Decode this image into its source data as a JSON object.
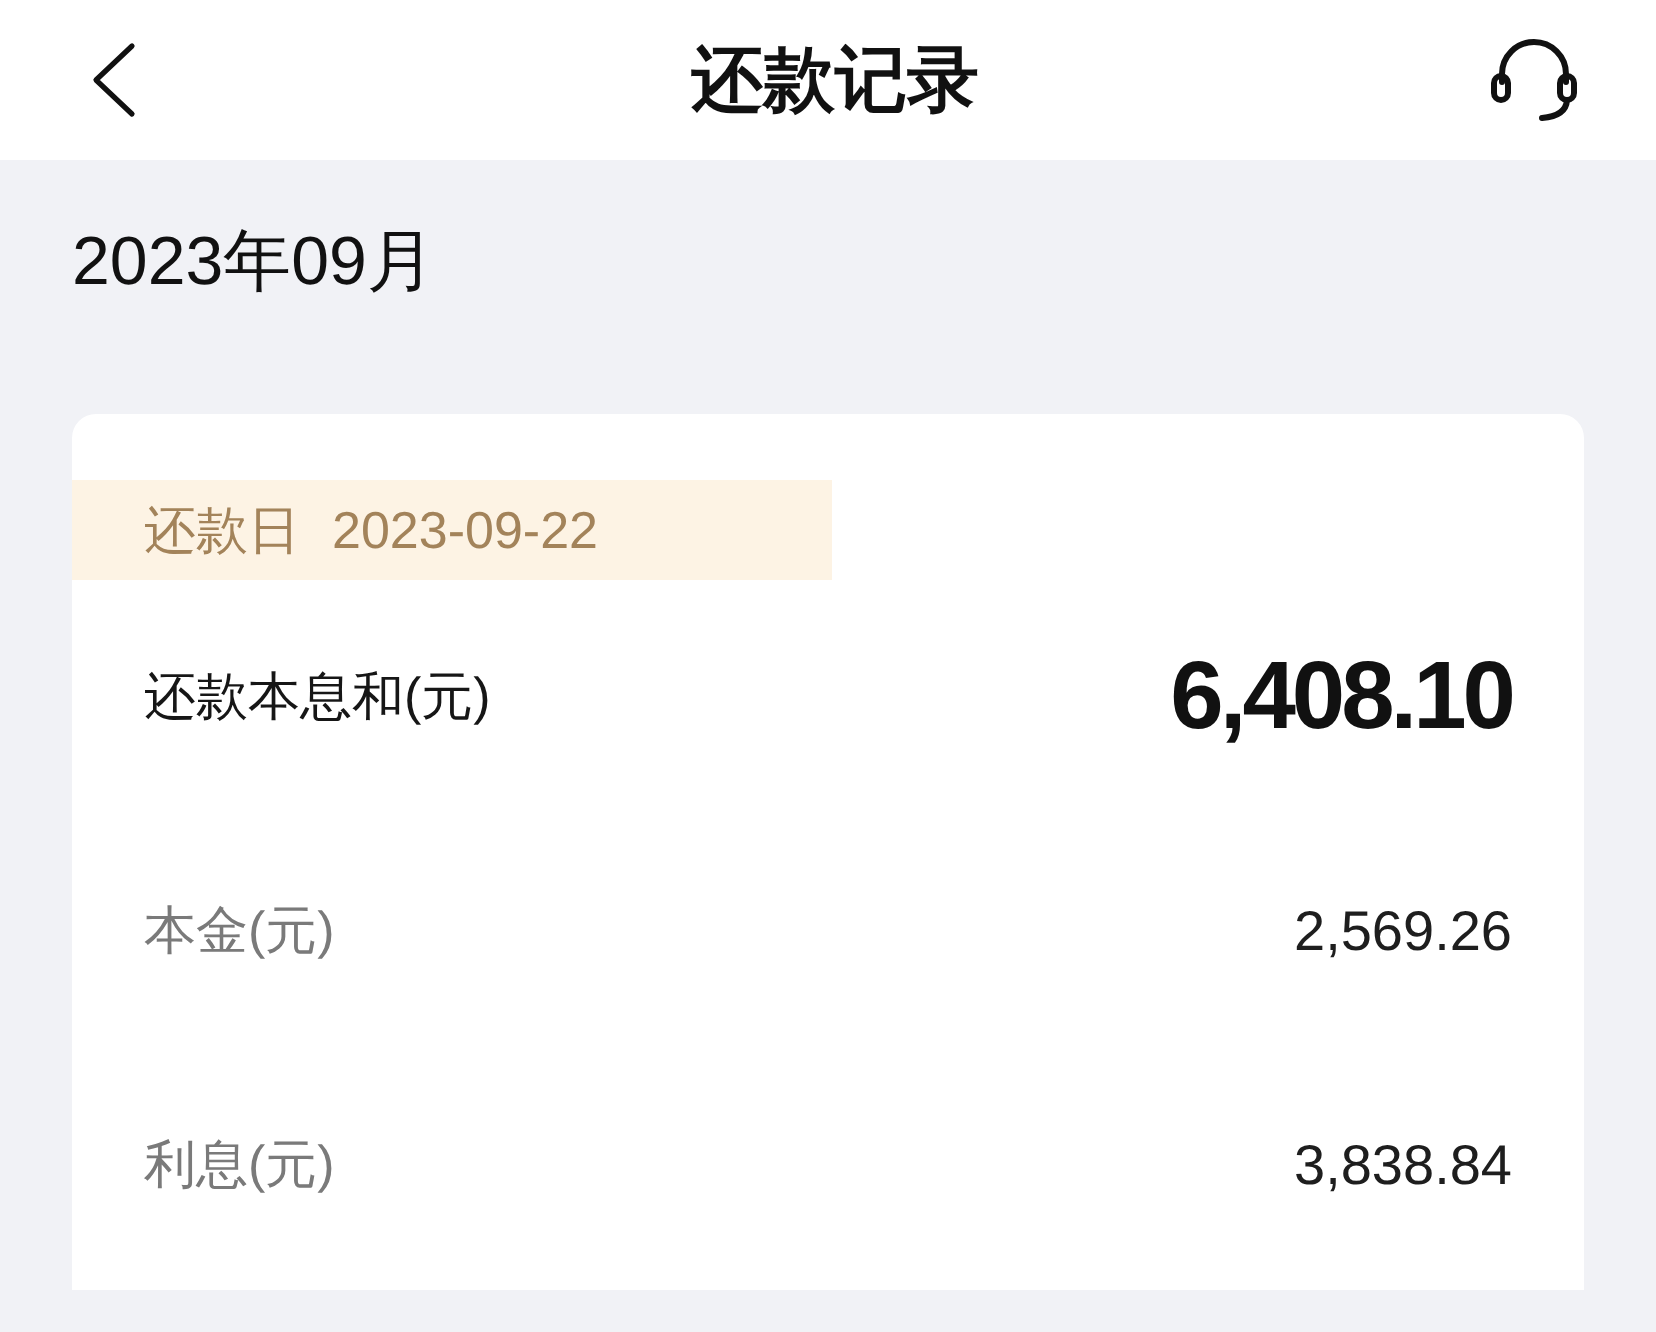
{
  "header": {
    "title": "还款记录"
  },
  "month": "2023年09月",
  "record": {
    "date_label": "还款日",
    "date": "2023-09-22",
    "rows": [
      {
        "kind": "total",
        "label": "还款本息和(元)",
        "value": "6,408.10"
      },
      {
        "kind": "detail",
        "label": "本金(元)",
        "value": "2,569.26"
      },
      {
        "kind": "detail",
        "label": "利息(元)",
        "value": "3,838.84"
      }
    ]
  }
}
